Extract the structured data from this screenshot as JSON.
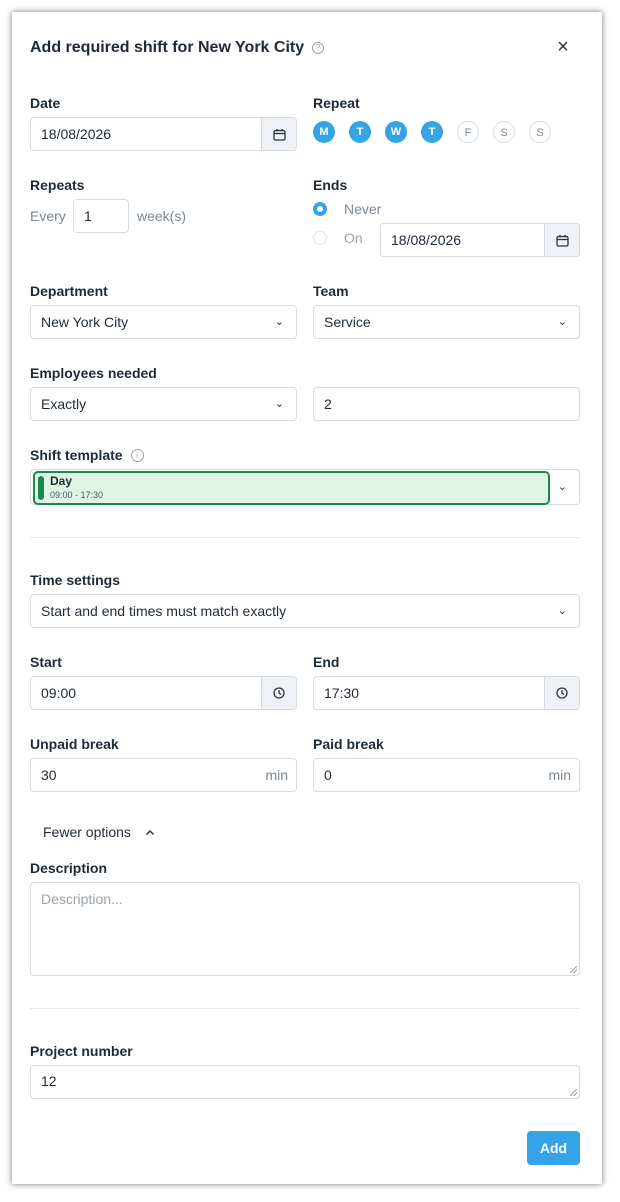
{
  "title": "Add required shift for New York City",
  "date": {
    "label": "Date",
    "value": "18/08/2026"
  },
  "repeat": {
    "label": "Repeat",
    "days": [
      {
        "letter": "M",
        "active": true
      },
      {
        "letter": "T",
        "active": true
      },
      {
        "letter": "W",
        "active": true
      },
      {
        "letter": "T",
        "active": true
      },
      {
        "letter": "F",
        "active": false
      },
      {
        "letter": "S",
        "active": false
      },
      {
        "letter": "S",
        "active": false
      }
    ]
  },
  "repeats": {
    "label": "Repeats",
    "every": "Every",
    "value": "1",
    "unit": "week(s)"
  },
  "ends": {
    "label": "Ends",
    "never": "Never",
    "on": "On",
    "date": "18/08/2026",
    "selected": "never"
  },
  "department": {
    "label": "Department",
    "value": "New York City"
  },
  "team": {
    "label": "Team",
    "value": "Service"
  },
  "employees": {
    "label": "Employees needed",
    "mode": "Exactly",
    "count": "2"
  },
  "shift_template": {
    "label": "Shift template",
    "name": "Day",
    "time": "09:00 - 17:30",
    "color": "#1a8a4a",
    "bg": "#def5e6"
  },
  "time_settings": {
    "label": "Time settings",
    "value": "Start and end times must match exactly"
  },
  "start": {
    "label": "Start",
    "value": "09:00"
  },
  "end": {
    "label": "End",
    "value": "17:30"
  },
  "unpaid_break": {
    "label": "Unpaid break",
    "value": "30",
    "unit": "min"
  },
  "paid_break": {
    "label": "Paid break",
    "value": "0",
    "unit": "min"
  },
  "fewer_options": "Fewer options",
  "description": {
    "label": "Description",
    "placeholder": "Description..."
  },
  "project_number": {
    "label": "Project number",
    "value": "12"
  },
  "add_button": "Add",
  "colors": {
    "accent": "#34a3e8",
    "text": "#1f2a37",
    "muted": "#7b8794",
    "border": "#d5dae0"
  }
}
